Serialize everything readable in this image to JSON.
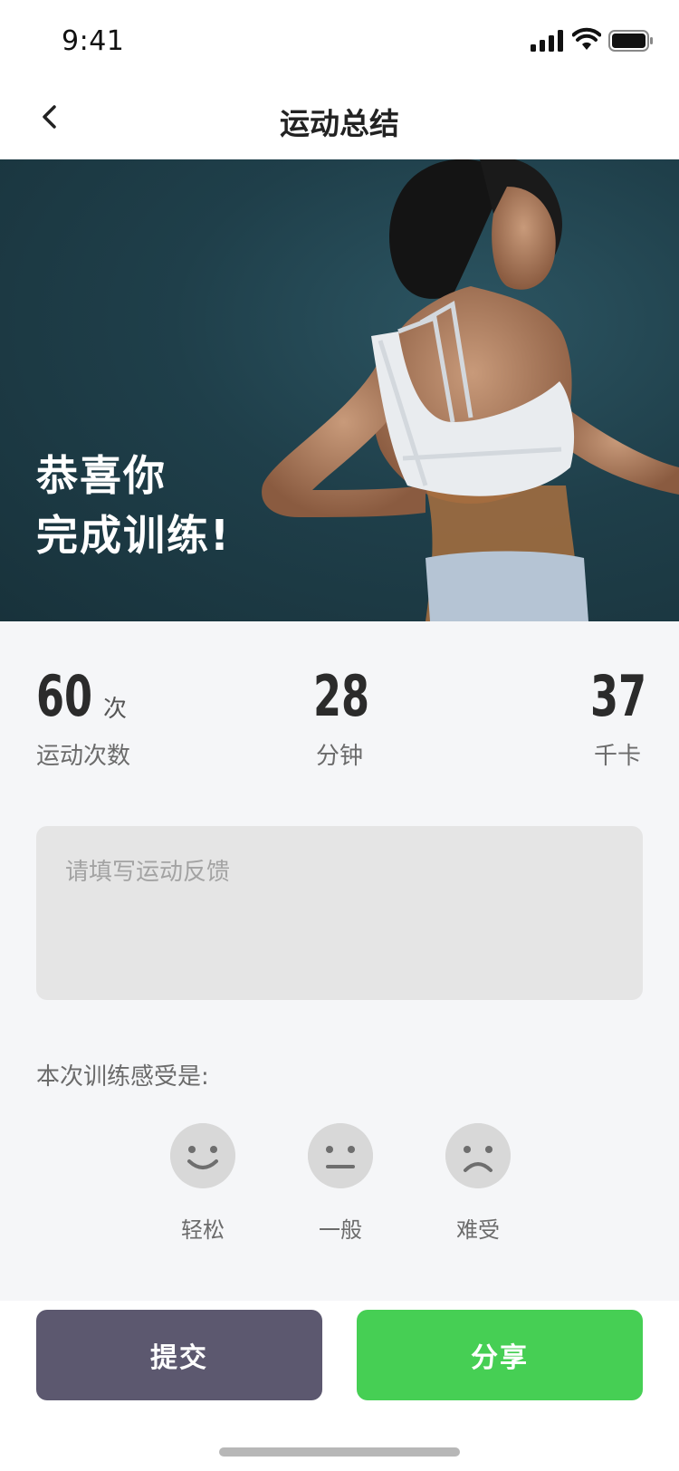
{
  "status_bar": {
    "time": "9:41"
  },
  "nav": {
    "title": "运动总结"
  },
  "hero": {
    "line1": "恭喜你",
    "line2": "完成训练!"
  },
  "stats": {
    "count": {
      "value": "60",
      "unit": "次",
      "label": "运动次数"
    },
    "duration": {
      "value": "28",
      "label": "分钟"
    },
    "calories": {
      "value": "37",
      "label": "千卡"
    }
  },
  "feedback": {
    "placeholder": "请填写运动反馈",
    "value": ""
  },
  "feeling": {
    "prompt": "本次训练感受是:",
    "options": [
      {
        "label": "轻松",
        "icon": "smile-icon"
      },
      {
        "label": "一般",
        "icon": "neutral-face-icon"
      },
      {
        "label": "难受",
        "icon": "sad-face-icon"
      }
    ]
  },
  "actions": {
    "submit_label": "提交",
    "share_label": "分享"
  },
  "colors": {
    "share": "#46cf54",
    "submit": "#5c586f",
    "hero_bg": "#1f3f4a"
  }
}
